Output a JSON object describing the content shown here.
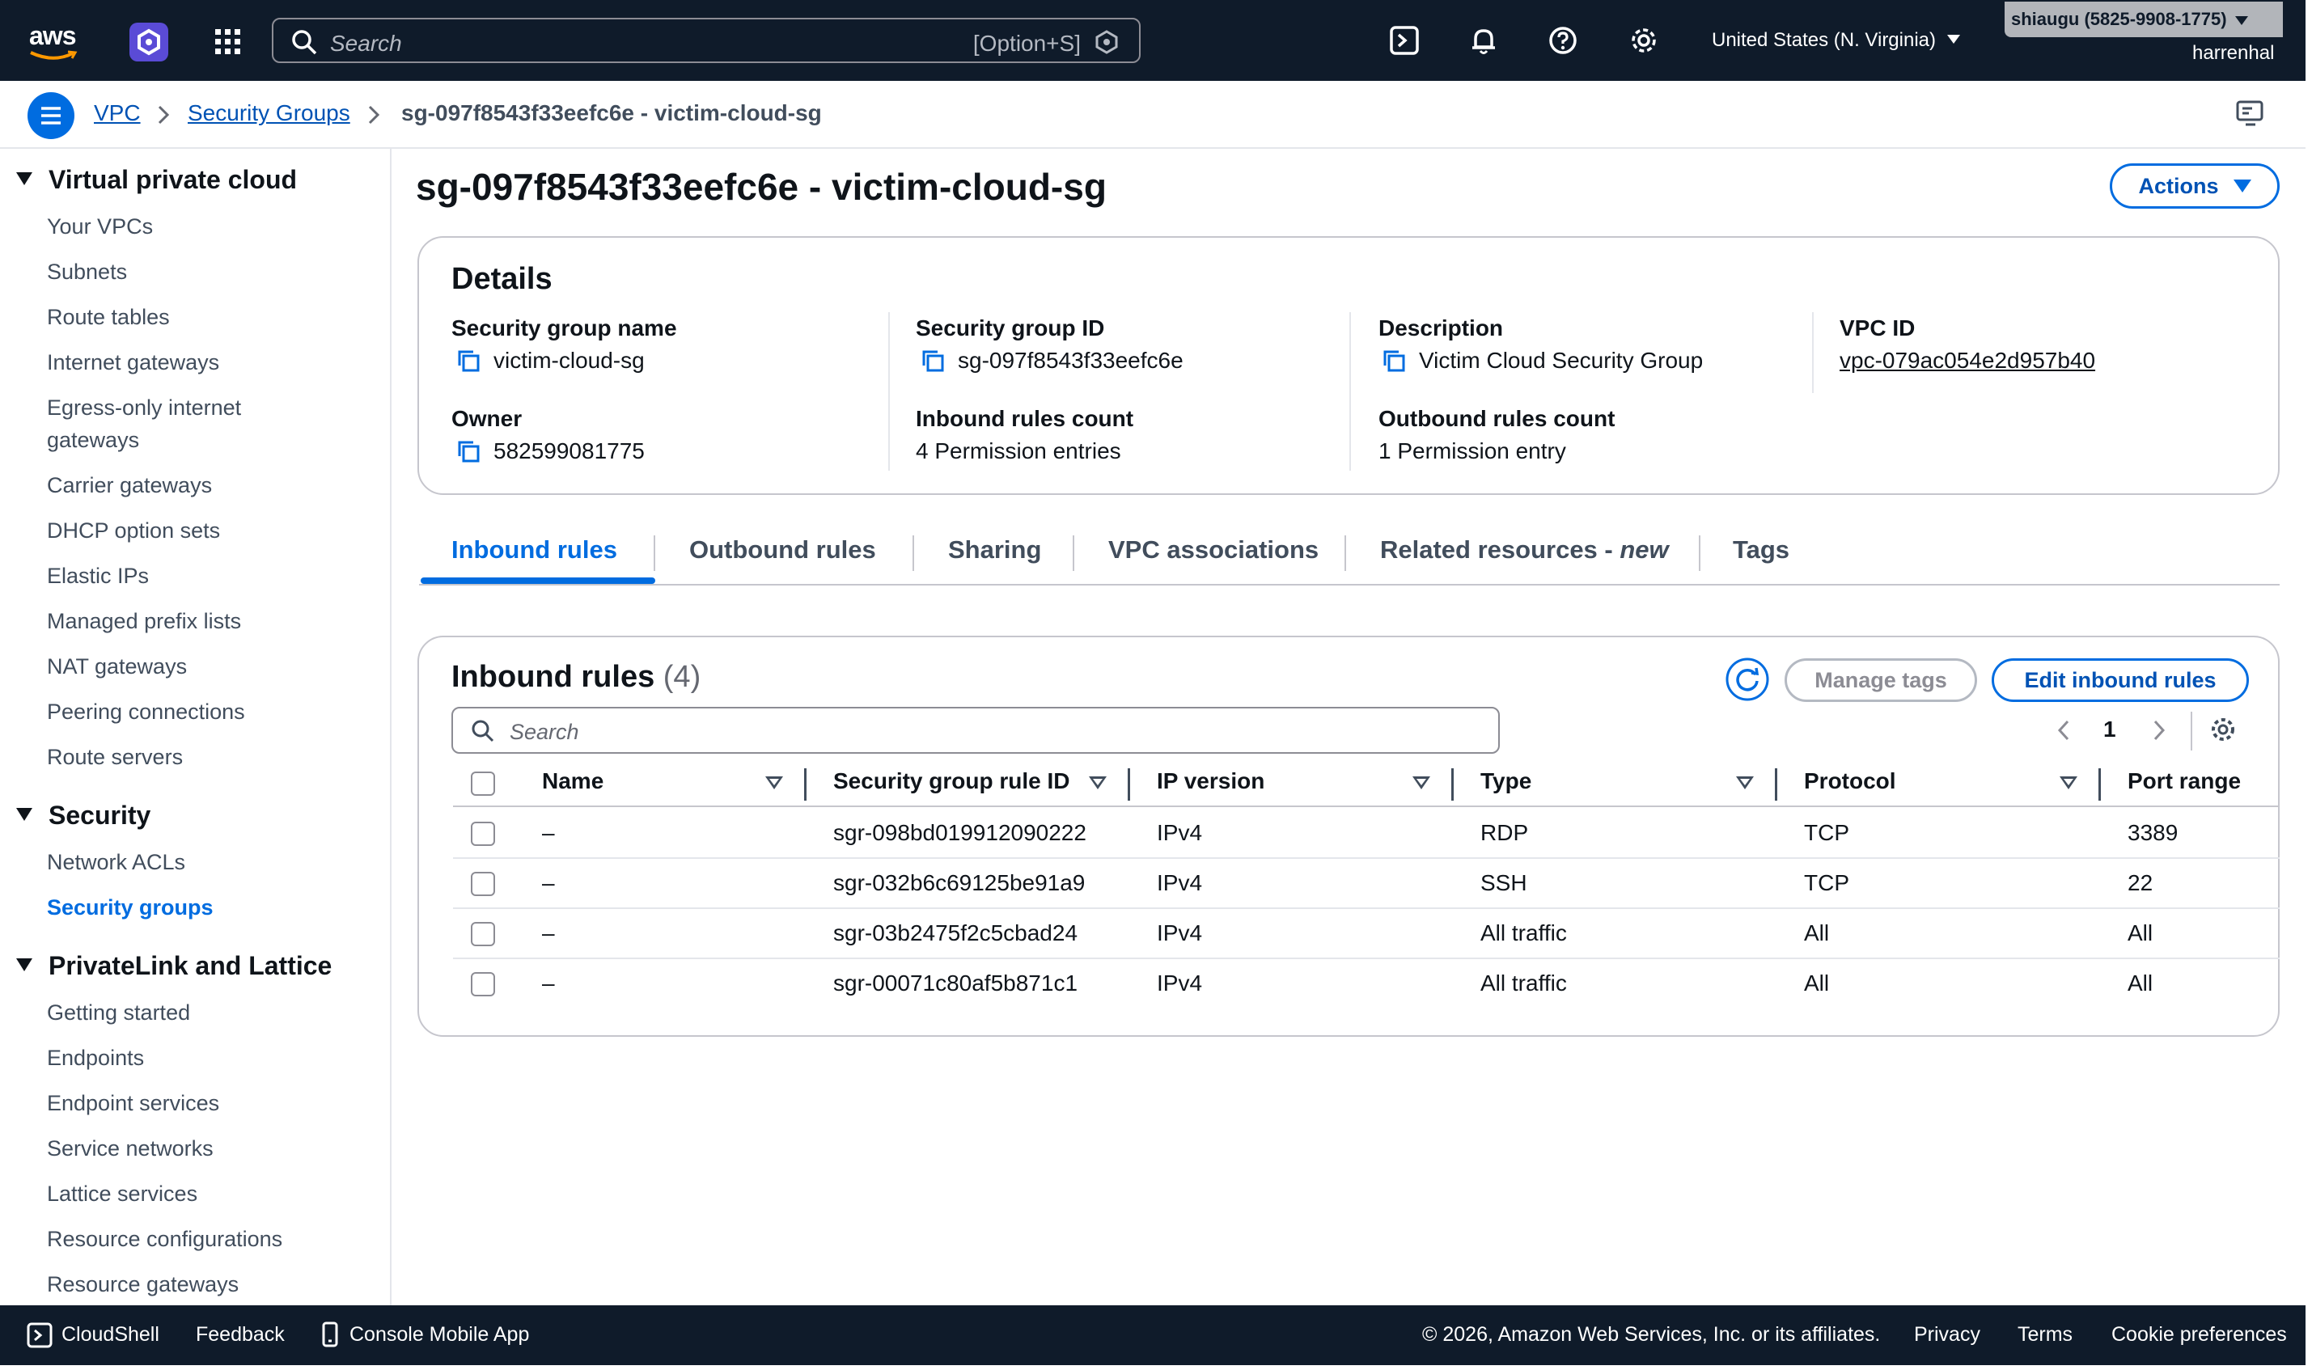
{
  "topnav": {
    "logo_text": "aws",
    "search_placeholder": "Search",
    "search_shortcut": "[Option+S]",
    "region": "United States (N. Virginia)",
    "account": "shiaugu (5825-9908-1775)",
    "user": "harrenhal"
  },
  "breadcrumb": {
    "vpc": "VPC",
    "security_groups": "Security Groups",
    "current": "sg-097f8543f33eefc6e - victim-cloud-sg"
  },
  "sidebar": {
    "sections": [
      {
        "title": "Virtual private cloud",
        "items": [
          "Your VPCs",
          "Subnets",
          "Route tables",
          "Internet gateways",
          "Egress-only internet gateways",
          "Carrier gateways",
          "DHCP option sets",
          "Elastic IPs",
          "Managed prefix lists",
          "NAT gateways",
          "Peering connections",
          "Route servers"
        ]
      },
      {
        "title": "Security",
        "items": [
          "Network ACLs",
          "Security groups"
        ]
      },
      {
        "title": "PrivateLink and Lattice",
        "items": [
          "Getting started",
          "Endpoints",
          "Endpoint services",
          "Service networks",
          "Lattice services",
          "Resource configurations",
          "Resource gateways"
        ]
      }
    ],
    "egress_line1": "Egress-only internet",
    "egress_line2": "gateways"
  },
  "page": {
    "title": "sg-097f8543f33eefc6e - victim-cloud-sg",
    "actions_label": "Actions"
  },
  "details": {
    "heading": "Details",
    "sg_name_label": "Security group name",
    "sg_name": "victim-cloud-sg",
    "sg_id_label": "Security group ID",
    "sg_id": "sg-097f8543f33eefc6e",
    "description_label": "Description",
    "description": "Victim Cloud Security Group",
    "vpc_id_label": "VPC ID",
    "vpc_id": "vpc-079ac054e2d957b40",
    "owner_label": "Owner",
    "owner": "582599081775",
    "inbound_count_label": "Inbound rules count",
    "inbound_count": "4 Permission entries",
    "outbound_count_label": "Outbound rules count",
    "outbound_count": "1 Permission entry"
  },
  "tabs": {
    "inbound": "Inbound rules",
    "outbound": "Outbound rules",
    "sharing": "Sharing",
    "vpc_assoc": "VPC associations",
    "related": "Related resources - ",
    "related_new": "new",
    "tags": "Tags"
  },
  "inbound": {
    "heading": "Inbound rules",
    "count": "(4)",
    "manage_tags": "Manage tags",
    "edit": "Edit inbound rules",
    "search_placeholder": "Search",
    "page": "1",
    "columns": [
      "Name",
      "Security group rule ID",
      "IP version",
      "Type",
      "Protocol",
      "Port range"
    ],
    "rows": [
      {
        "name": "–",
        "rule_id": "sgr-098bd019912090222",
        "ip": "IPv4",
        "type": "RDP",
        "protocol": "TCP",
        "port": "3389"
      },
      {
        "name": "–",
        "rule_id": "sgr-032b6c69125be91a9",
        "ip": "IPv4",
        "type": "SSH",
        "protocol": "TCP",
        "port": "22"
      },
      {
        "name": "–",
        "rule_id": "sgr-03b2475f2c5cbad24",
        "ip": "IPv4",
        "type": "All traffic",
        "protocol": "All",
        "port": "All"
      },
      {
        "name": "–",
        "rule_id": "sgr-00071c80af5b871c1",
        "ip": "IPv4",
        "type": "All traffic",
        "protocol": "All",
        "port": "All"
      }
    ]
  },
  "footer": {
    "cloudshell": "CloudShell",
    "feedback": "Feedback",
    "mobile": "Console Mobile App",
    "copyright": "© 2026, Amazon Web Services, Inc. or its affiliates.",
    "privacy": "Privacy",
    "terms": "Terms",
    "cookies": "Cookie preferences"
  },
  "colors": {
    "nav": "#0f1b2a",
    "accent": "#006ce0",
    "link": "#0052b4"
  }
}
